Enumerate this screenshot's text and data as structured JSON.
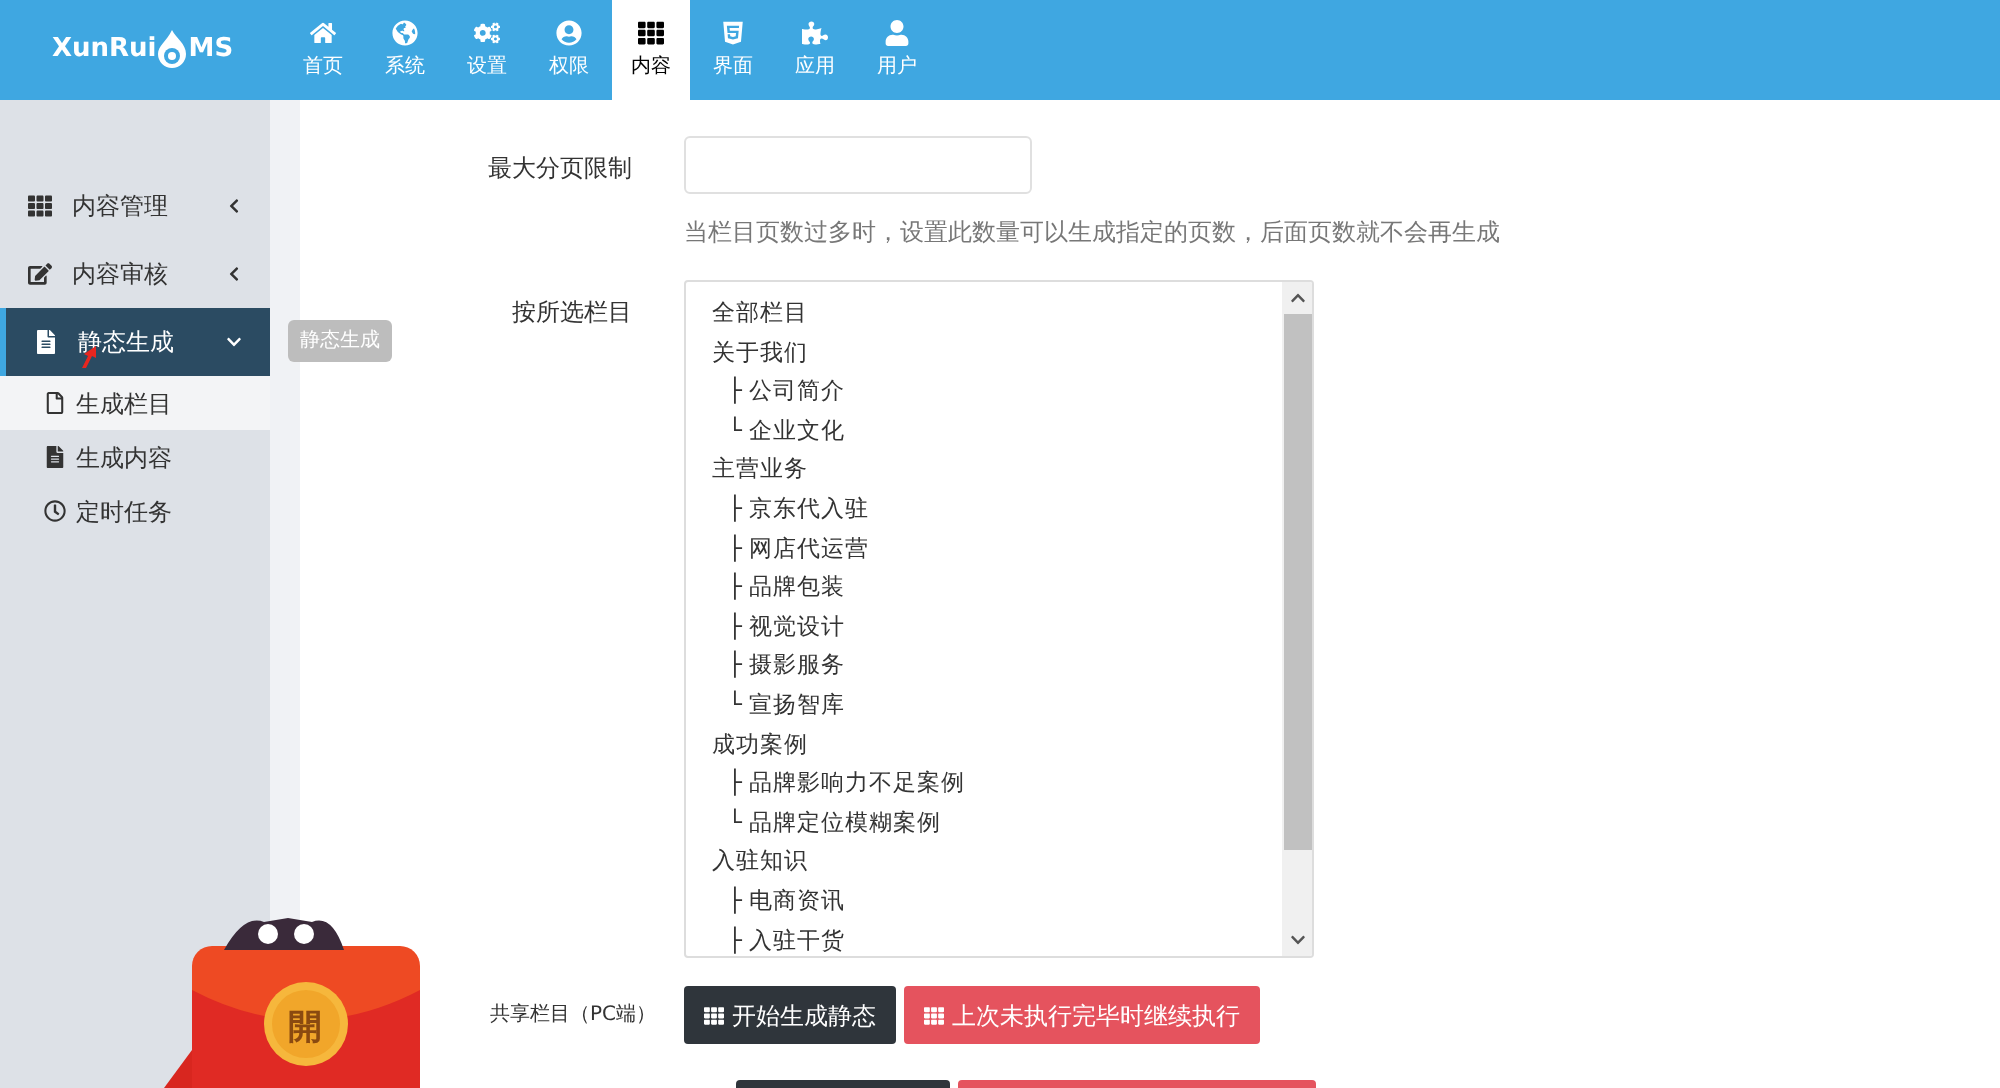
{
  "logo": {
    "text_before": "XunRui",
    "text_after": "MS"
  },
  "nav": [
    {
      "label": "首页",
      "selected": false
    },
    {
      "label": "系统",
      "selected": false
    },
    {
      "label": "设置",
      "selected": false
    },
    {
      "label": "权限",
      "selected": false
    },
    {
      "label": "内容",
      "selected": true
    },
    {
      "label": "界面",
      "selected": false
    },
    {
      "label": "应用",
      "selected": false
    },
    {
      "label": "用户",
      "selected": false
    }
  ],
  "sidebar": {
    "items": [
      {
        "label": "内容管理",
        "expanded": false,
        "selected": false
      },
      {
        "label": "内容审核",
        "expanded": false,
        "selected": false
      },
      {
        "label": "静态生成",
        "expanded": true,
        "selected": true,
        "tooltip": "静态生成",
        "children": [
          {
            "label": "生成栏目",
            "selected": true
          },
          {
            "label": "生成内容",
            "selected": false
          },
          {
            "label": "定时任务",
            "selected": false
          }
        ]
      }
    ]
  },
  "form": {
    "max_pages": {
      "label": "最大分页限制",
      "help": "当栏目页数过多时，设置此数量可以生成指定的页数，后面页数就不会再生成"
    },
    "categories": {
      "label": "按所选栏目",
      "options": [
        {
          "text": "全部栏目"
        },
        {
          "text": "关于我们",
          "children": [
            {
              "text": "├ 公司简介"
            },
            {
              "text": "└ 企业文化"
            }
          ]
        },
        {
          "text": "主营业务",
          "children": [
            {
              "text": "├ 京东代入驻"
            },
            {
              "text": "├ 网店代运营"
            },
            {
              "text": "├ 品牌包装"
            },
            {
              "text": "├ 视觉设计"
            },
            {
              "text": "├ 摄影服务"
            },
            {
              "text": "└ 宣扬智库"
            }
          ]
        },
        {
          "text": "成功案例",
          "children": [
            {
              "text": "├ 品牌影响力不足案例"
            },
            {
              "text": "└ 品牌定位模糊案例"
            }
          ]
        },
        {
          "text": "入驻知识",
          "children": [
            {
              "text": "├ 电商资讯"
            },
            {
              "text": "├ 入驻干货"
            }
          ]
        }
      ]
    },
    "action_row": {
      "label": "共享栏目（PC端）",
      "buttons": [
        {
          "label": "开始生成静态",
          "kind": "dark"
        },
        {
          "label": "上次未执行完毕时继续执行",
          "kind": "danger"
        }
      ]
    }
  },
  "promo": {
    "label": "開"
  }
}
